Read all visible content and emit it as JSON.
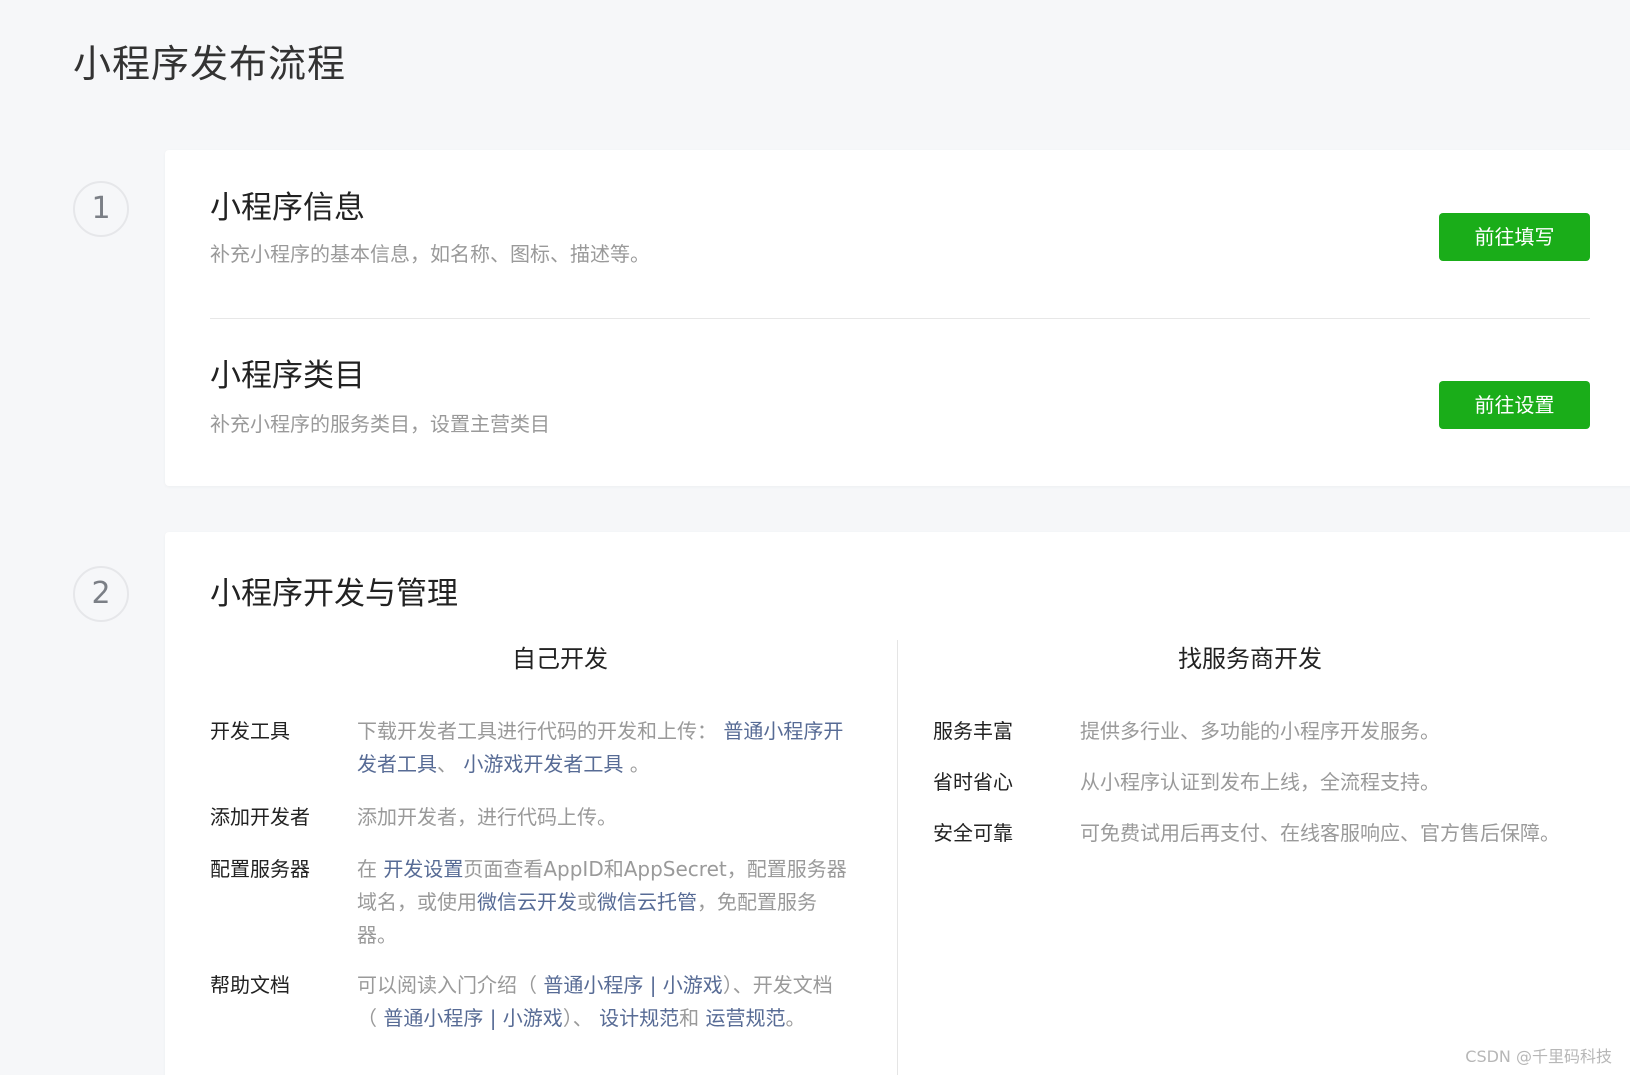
{
  "page": {
    "title": "小程序发布流程"
  },
  "steps": [
    {
      "number": "1"
    },
    {
      "number": "2"
    }
  ],
  "card1": {
    "rows": [
      {
        "title": "小程序信息",
        "desc": "补充小程序的基本信息，如名称、图标、描述等。",
        "button": "前往填写"
      },
      {
        "title": "小程序类目",
        "desc": "补充小程序的服务类目，设置主营类目",
        "button": "前往设置"
      }
    ]
  },
  "card2": {
    "title": "小程序开发与管理",
    "self_dev": {
      "heading": "自己开发",
      "items": [
        {
          "label": "开发工具",
          "parts": [
            {
              "text": "下载开发者工具进行代码的开发和上传： "
            },
            {
              "text": "普通小程序开发者工具",
              "link": true
            },
            {
              "text": "、 "
            },
            {
              "text": "小游戏开发者工具",
              "link": true
            },
            {
              "text": " 。"
            }
          ]
        },
        {
          "label": "添加开发者",
          "parts": [
            {
              "text": "添加开发者，进行代码上传。"
            }
          ]
        },
        {
          "label": "配置服务器",
          "parts": [
            {
              "text": "在 "
            },
            {
              "text": "开发设置",
              "link": true
            },
            {
              "text": "页面查看AppID和AppSecret，配置服务器域名，或使用"
            },
            {
              "text": "微信云开发",
              "link": true
            },
            {
              "text": "或"
            },
            {
              "text": "微信云托管",
              "link": true
            },
            {
              "text": "，免配置服务器。"
            }
          ]
        },
        {
          "label": "帮助文档",
          "parts": [
            {
              "text": "可以阅读入门介绍（ "
            },
            {
              "text": "普通小程序 | 小游戏",
              "link": true
            },
            {
              "text": "）、开发文档（ "
            },
            {
              "text": "普通小程序 | 小游戏",
              "link": true
            },
            {
              "text": "）、 "
            },
            {
              "text": "设计规范",
              "link": true
            },
            {
              "text": "和 "
            },
            {
              "text": "运营规范",
              "link": true
            },
            {
              "text": "。"
            }
          ]
        }
      ]
    },
    "provider_dev": {
      "heading": "找服务商开发",
      "items": [
        {
          "label": "服务丰富",
          "value": "提供多行业、多功能的小程序开发服务。"
        },
        {
          "label": "省时省心",
          "value": "从小程序认证到发布上线，全流程支持。"
        },
        {
          "label": "安全可靠",
          "value": "可免费试用后再支付、在线客服响应、官方售后保障。"
        }
      ]
    }
  },
  "watermark": "CSDN @千里码科技"
}
